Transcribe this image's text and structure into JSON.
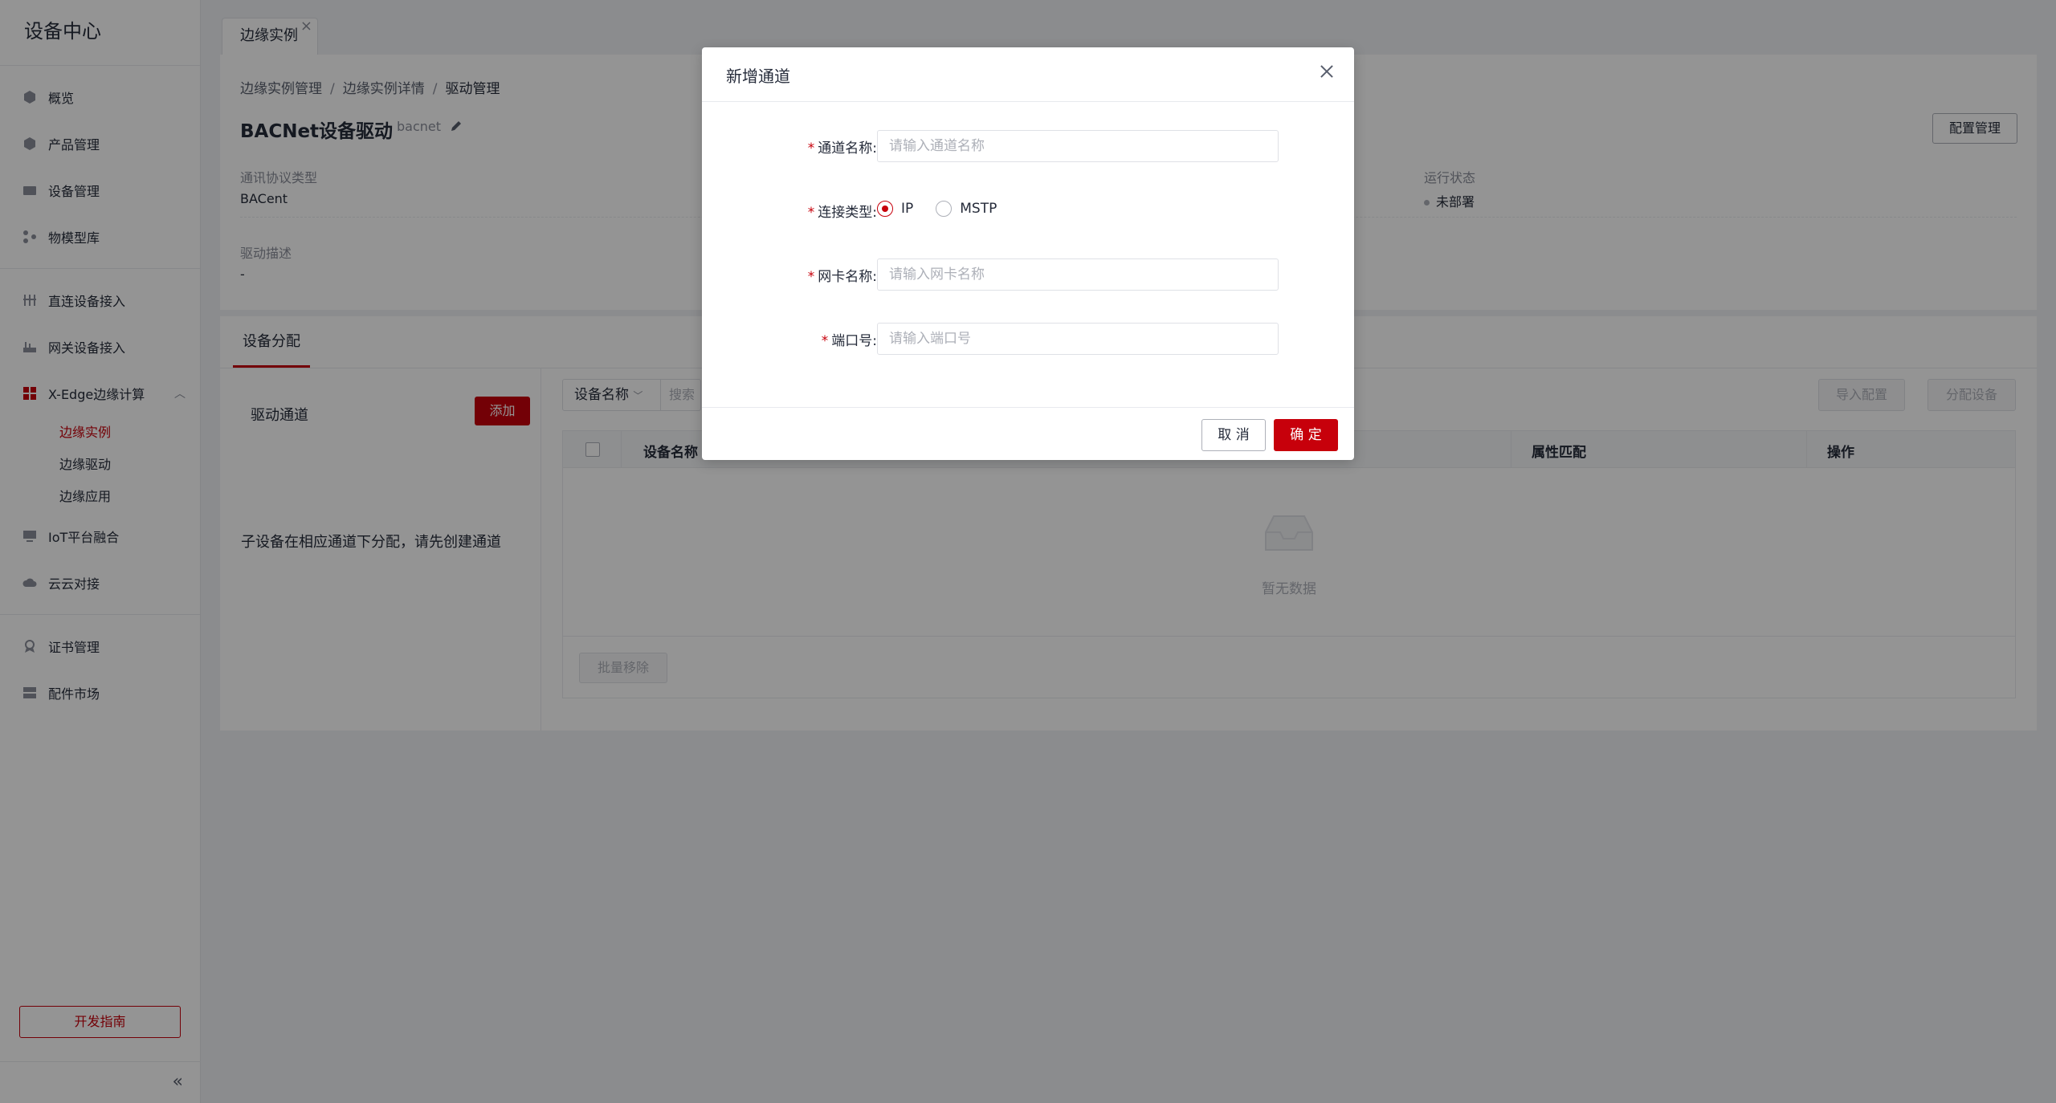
{
  "sidebar": {
    "title": "设备中心",
    "items": [
      {
        "label": "概览",
        "icon": "dashboard-icon"
      },
      {
        "label": "产品管理",
        "icon": "cube-icon"
      },
      {
        "label": "设备管理",
        "icon": "device-icon"
      },
      {
        "label": "物模型库",
        "icon": "model-icon"
      },
      {
        "label": "直连设备接入",
        "icon": "direct-connect-icon"
      },
      {
        "label": "网关设备接入",
        "icon": "gateway-icon"
      },
      {
        "label": "X-Edge边缘计算",
        "icon": "grid-icon"
      },
      {
        "label": "IoT平台融合",
        "icon": "platform-icon"
      },
      {
        "label": "云云对接",
        "icon": "cloud-icon"
      },
      {
        "label": "证书管理",
        "icon": "certificate-icon"
      },
      {
        "label": "配件市场",
        "icon": "market-icon"
      }
    ],
    "subitems": [
      "边缘实例",
      "边缘驱动",
      "边缘应用"
    ],
    "guide_button": "开发指南",
    "accent_color": "#c7000b"
  },
  "tabs": [
    {
      "label": "边缘实例"
    }
  ],
  "breadcrumb": [
    "边缘实例管理",
    "边缘实例详情",
    "驱动管理"
  ],
  "breadcrumb_sep": "/",
  "page": {
    "title": "BACNet设备驱动",
    "subtitle": "bacnet",
    "config_button": "配置管理",
    "protocol_label": "通讯协议类型",
    "protocol_value": "BACent",
    "status_label": "运行状态",
    "status_value": "未部署",
    "desc_label": "驱动描述",
    "desc_value": "-"
  },
  "section": {
    "tab": "设备分配",
    "channel_title": "驱动通道",
    "add_button": "添加",
    "hint": "子设备在相应通道下分配，请先创建通道",
    "filter_select": "设备名称",
    "search_placeholder": "搜索",
    "import_button": "导入配置",
    "assign_button": "分配设备",
    "columns": [
      "设备名称",
      "属性匹配",
      "操作"
    ],
    "empty_text": "暂无数据",
    "bulk_button": "批量移除"
  },
  "modal": {
    "title": "新增通道",
    "fields": {
      "name_label": "通道名称:",
      "name_placeholder": "请输入通道名称",
      "type_label": "连接类型:",
      "type_options": [
        "IP",
        "MSTP"
      ],
      "type_selected": "IP",
      "nic_label": "网卡名称:",
      "nic_placeholder": "请输入网卡名称",
      "port_label": "端口号:",
      "port_placeholder": "请输入端口号"
    },
    "required_mark": "*",
    "cancel_button": "取 消",
    "ok_button": "确 定"
  }
}
